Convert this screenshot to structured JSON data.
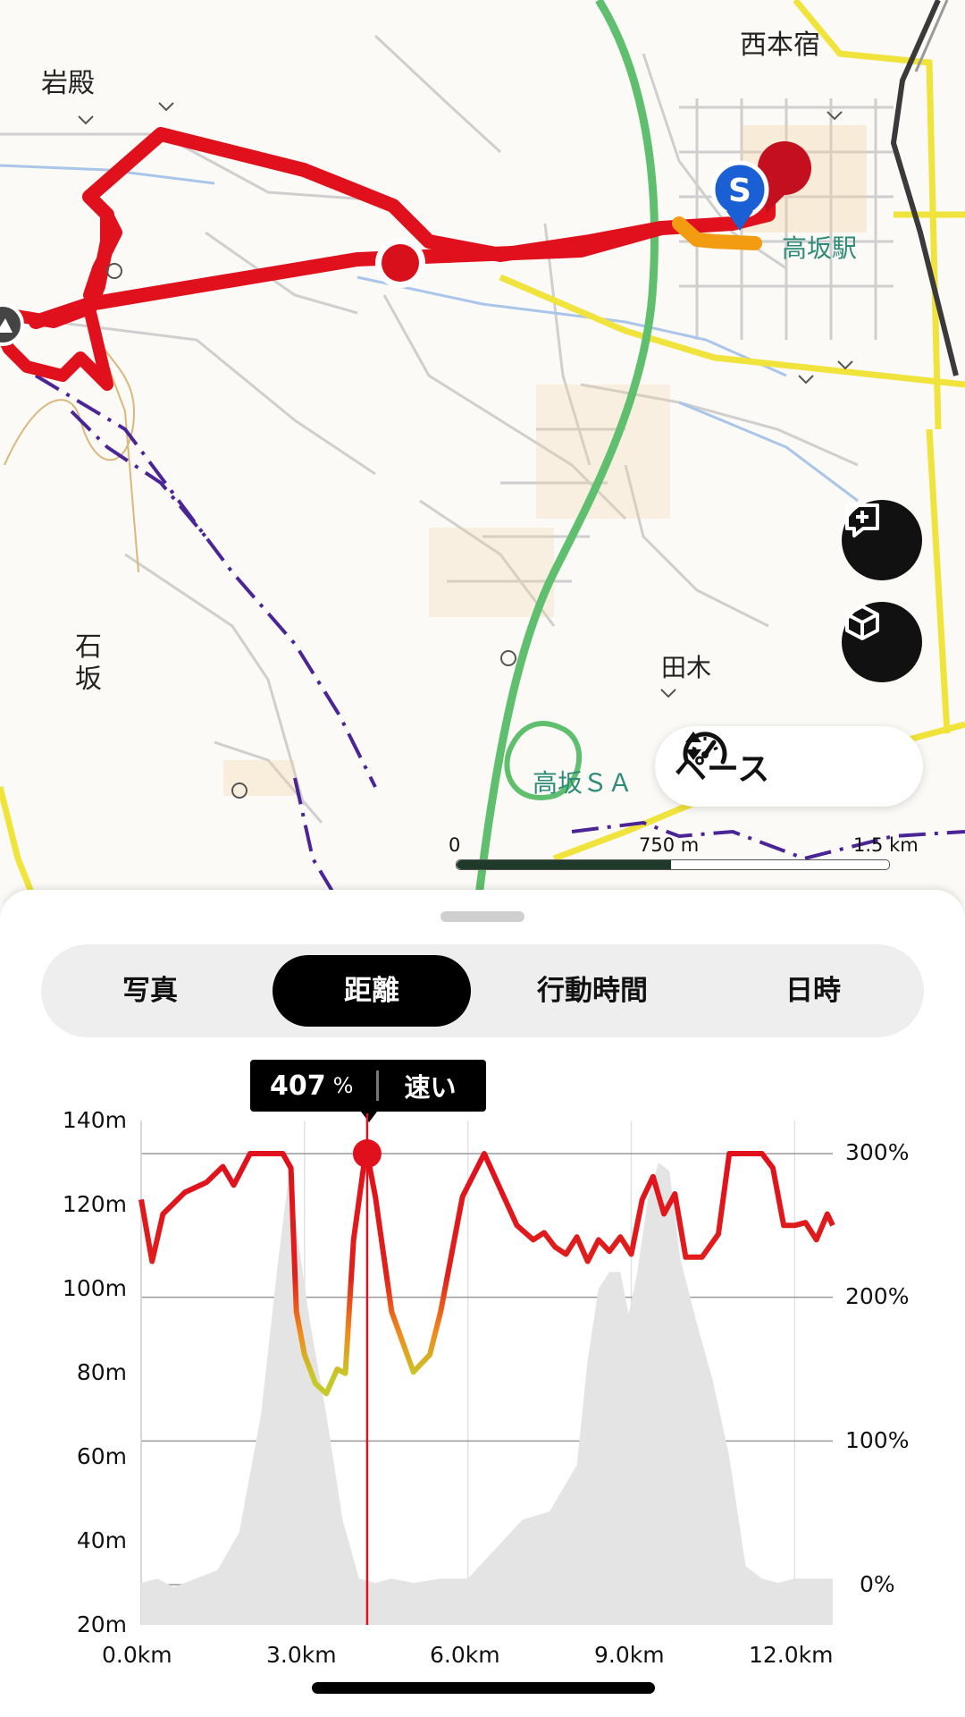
{
  "map": {
    "labels": {
      "iwadono": "岩殿",
      "nishihonjuku": "西本宿",
      "takasaka_station": "高坂駅",
      "ishizaka": "石坂",
      "taki": "田木",
      "takasaka_sa": "高坂ＳＡ"
    },
    "start_marker": "S",
    "scale": {
      "zero": "0",
      "mid": "750 m",
      "max": "1.5 km"
    },
    "pace_selector": {
      "label": "ペース",
      "icon": "speedometer-icon"
    },
    "buttons": {
      "add_icon": "add-comment-icon",
      "view3d_icon": "cube-icon"
    },
    "colors": {
      "route": "#e0101c",
      "highway": "#5fbf6e",
      "main_road": "#f0e33c",
      "rail": "#333333"
    }
  },
  "tabs": [
    {
      "label": "写真",
      "active": false
    },
    {
      "label": "距離",
      "active": true
    },
    {
      "label": "行動時間",
      "active": false
    },
    {
      "label": "日時",
      "active": false
    }
  ],
  "tooltip": {
    "value": "407",
    "unit": "%",
    "speed": "速い"
  },
  "chart_data": {
    "type": "line",
    "x_unit": "km",
    "x_ticks": [
      "0.0km",
      "3.0km",
      "6.0km",
      "9.0km",
      "12.0km"
    ],
    "x_range": [
      0,
      12.7
    ],
    "left_axis": {
      "label": "elevation",
      "ticks": [
        "140m",
        "120m",
        "100m",
        "80m",
        "60m",
        "40m",
        "20m"
      ],
      "range": [
        20,
        140
      ]
    },
    "right_axis": {
      "ticks": [
        "300%",
        "200%",
        "100%",
        "0%"
      ],
      "range": [
        0,
        300
      ]
    },
    "grid": true,
    "cursor_x": 4.15,
    "series": [
      {
        "kind": "elevation-area",
        "x": [
          0,
          0.3,
          0.6,
          1.0,
          1.4,
          1.8,
          2.2,
          2.5,
          2.7,
          2.9,
          3.1,
          3.4,
          3.7,
          4.0,
          4.3,
          4.6,
          5.0,
          5.5,
          6.0,
          6.5,
          7.0,
          7.5,
          8.0,
          8.2,
          8.4,
          8.6,
          8.8,
          8.95,
          9.1,
          9.3,
          9.5,
          9.7,
          9.9,
          10.2,
          10.5,
          10.8,
          11.1,
          11.4,
          11.7,
          12.0,
          12.3,
          12.7
        ],
        "y": [
          30,
          31,
          29,
          31,
          33,
          42,
          70,
          105,
          126,
          110,
          92,
          70,
          45,
          31,
          30,
          31,
          30,
          31,
          31,
          38,
          45,
          47,
          58,
          83,
          100,
          104,
          104,
          94,
          103,
          121,
          130,
          128,
          107,
          92,
          78,
          60,
          34,
          31,
          30,
          31,
          31,
          31
        ]
      },
      {
        "kind": "pace",
        "x": [
          0,
          0.2,
          0.4,
          0.8,
          1.2,
          1.5,
          1.7,
          2.0,
          2.2,
          2.4,
          2.6,
          2.75,
          2.85,
          3.0,
          3.2,
          3.4,
          3.6,
          3.75,
          3.9,
          4.1,
          4.15,
          4.3,
          4.6,
          5.0,
          5.3,
          5.5,
          5.9,
          6.3,
          6.6,
          6.9,
          7.2,
          7.4,
          7.6,
          7.8,
          8.0,
          8.2,
          8.4,
          8.6,
          8.8,
          9.0,
          9.2,
          9.4,
          9.6,
          9.8,
          10.0,
          10.3,
          10.6,
          10.8,
          11.0,
          11.2,
          11.4,
          11.6,
          11.8,
          12.0,
          12.2,
          12.4,
          12.6,
          12.7
        ],
        "y": [
          268,
          225,
          258,
          273,
          280,
          291,
          278,
          300,
          300,
          300,
          300,
          290,
          190,
          160,
          140,
          133,
          150,
          147,
          240,
          295,
          300,
          270,
          190,
          148,
          160,
          190,
          270,
          300,
          275,
          250,
          240,
          245,
          235,
          230,
          242,
          225,
          240,
          232,
          242,
          230,
          268,
          284,
          258,
          272,
          228,
          228,
          244,
          300,
          300,
          300,
          300,
          290,
          250,
          250,
          252,
          240,
          258,
          250
        ]
      }
    ]
  }
}
